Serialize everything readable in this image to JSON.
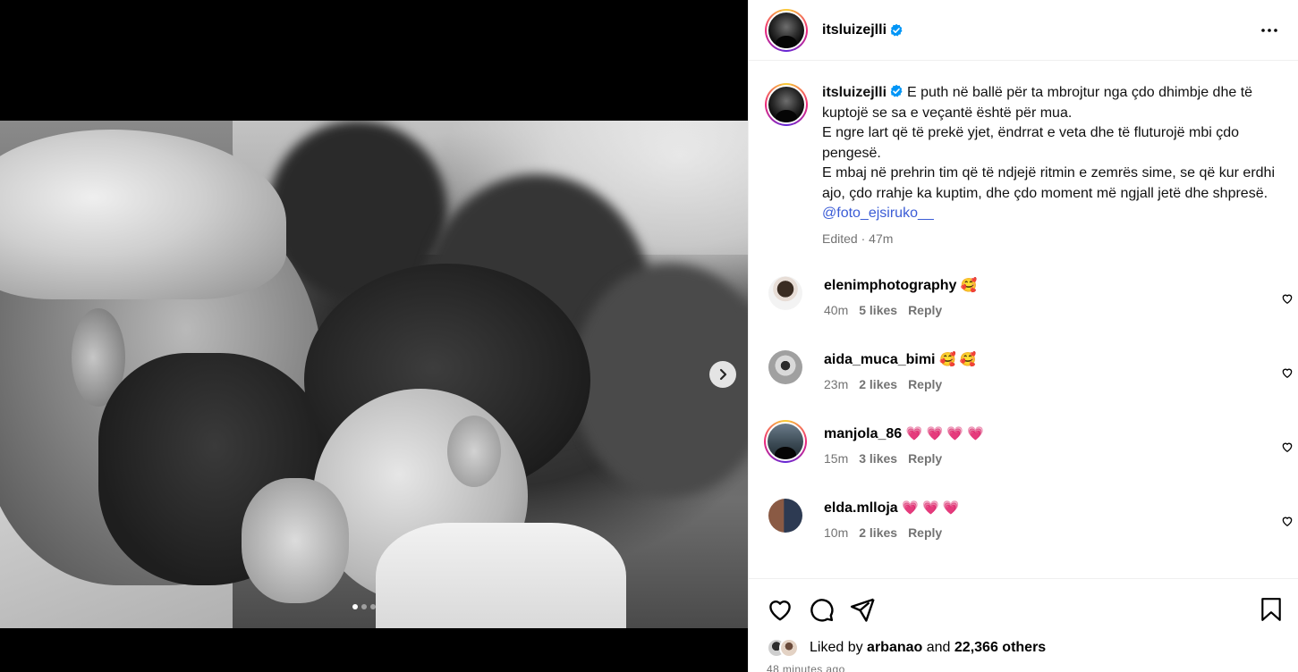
{
  "post": {
    "username": "itsluizejlli",
    "caption_lines": [
      "E puth në ballë për ta mbrojtur nga çdo dhimbje dhe të kuptojë se sa e veçantë është për mua.",
      "E ngre lart që të prekë yjet, ëndrrat e veta dhe të fluturojë mbi çdo pengesë.",
      "E mbaj në prehrin tim që të ndjejë ritmin e zemrës sime, se që kur erdhi ajo, çdo rrahje ka kuptim, dhe çdo moment më ngjall jetë dhe shpresë."
    ],
    "mention": "@foto_ejsiruko__",
    "edited": "Edited",
    "time": "47m"
  },
  "carousel": {
    "total": 3,
    "current": 1
  },
  "comments": [
    {
      "user": "elenimphotography",
      "text": "🥰",
      "time": "40m",
      "likes": "5 likes",
      "reply": "Reply"
    },
    {
      "user": "aida_muca_bimi",
      "text": "🥰 🥰",
      "time": "23m",
      "likes": "2 likes",
      "reply": "Reply"
    },
    {
      "user": "manjola_86",
      "text": "💗 💗 💗 💗",
      "time": "15m",
      "likes": "3 likes",
      "reply": "Reply"
    },
    {
      "user": "elda.mlloja",
      "text": "💗 💗 💗",
      "time": "10m",
      "likes": "2 likes",
      "reply": "Reply"
    }
  ],
  "likes": {
    "prefix": "Liked by",
    "user": "arbanao",
    "and": "and",
    "others": "22,366 others"
  },
  "ago": "48 minutes ago",
  "icons": {
    "verified": "verified-badge-icon",
    "more": "more-options-icon",
    "next": "chevron-right-icon",
    "like": "heart-icon",
    "comment": "comment-icon",
    "share": "share-icon",
    "save": "bookmark-icon"
  },
  "colors": {
    "verified": "#0095f6",
    "mention": "#3b5cd6",
    "muted": "#737373"
  }
}
